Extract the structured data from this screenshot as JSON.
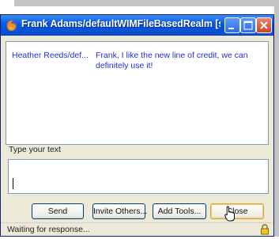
{
  "window": {
    "title": "Frank Adams/defaultWIMFileBasedRealm [started:..."
  },
  "chat": {
    "sender": "Heather Reeds/def...",
    "message": "Frank, I like the new line of credit, we can definitely use it!"
  },
  "compose": {
    "label": "Type your text",
    "value": ""
  },
  "buttons": {
    "send": "Send",
    "invite": "Invite Others...",
    "tools": "Add Tools...",
    "close": "Close"
  },
  "status": {
    "text": "Waiting for response..."
  },
  "icons": {
    "title": "firefox-icon",
    "lock": "lock-icon",
    "minimize": "minimize-icon",
    "maximize": "maximize-icon",
    "close": "close-icon",
    "cursor": "hand-cursor-icon"
  },
  "colors": {
    "titlebar": "#0859e3",
    "chat_text": "#1f2fd0",
    "close_button_accent": "#d8a230",
    "window_bg": "#ece9d8"
  }
}
